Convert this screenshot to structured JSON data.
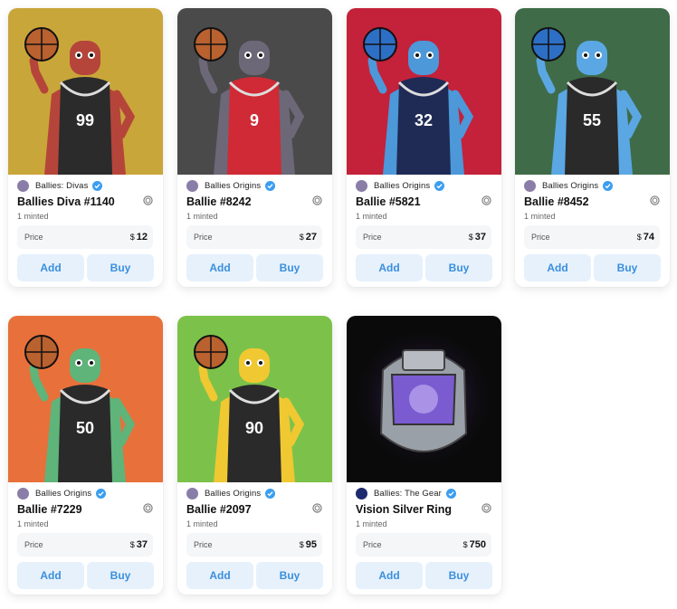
{
  "cards": [
    {
      "collection": "Ballies: Divas",
      "title": "Ballies Diva #1140",
      "minted": "1 minted",
      "price_label": "Price",
      "currency": "$",
      "price": "12",
      "add_label": "Add",
      "buy_label": "Buy",
      "bg": "#c9a63a",
      "jersey": "#2b2b2b",
      "skin": "#b5453a",
      "number": "99",
      "ball": "#b9612f"
    },
    {
      "collection": "Ballies Origins",
      "title": "Ballie #8242",
      "minted": "1 minted",
      "price_label": "Price",
      "currency": "$",
      "price": "27",
      "add_label": "Add",
      "buy_label": "Buy",
      "bg": "#4a4a4a",
      "jersey": "#cf2a35",
      "skin": "#6c6878",
      "number": "9",
      "ball": "#b9612f"
    },
    {
      "collection": "Ballies Origins",
      "title": "Ballie #5821",
      "minted": "1 minted",
      "price_label": "Price",
      "currency": "$",
      "price": "37",
      "add_label": "Add",
      "buy_label": "Buy",
      "bg": "#c4213a",
      "jersey": "#1f2b55",
      "skin": "#4c98d9",
      "number": "32",
      "ball": "#2d6fc4"
    },
    {
      "collection": "Ballies Origins",
      "title": "Ballie #8452",
      "minted": "1 minted",
      "price_label": "Price",
      "currency": "$",
      "price": "74",
      "add_label": "Add",
      "buy_label": "Buy",
      "bg": "#3f6b48",
      "jersey": "#2a2a2a",
      "skin": "#5aa7e3",
      "number": "55",
      "ball": "#2d6fc4"
    },
    {
      "collection": "Ballies Origins",
      "title": "Ballie #7229",
      "minted": "1 minted",
      "price_label": "Price",
      "currency": "$",
      "price": "37",
      "add_label": "Add",
      "buy_label": "Buy",
      "bg": "#e8703a",
      "jersey": "#2a2a2a",
      "skin": "#5fb47a",
      "number": "50",
      "ball": "#b9612f"
    },
    {
      "collection": "Ballies Origins",
      "title": "Ballie #2097",
      "minted": "1 minted",
      "price_label": "Price",
      "currency": "$",
      "price": "95",
      "add_label": "Add",
      "buy_label": "Buy",
      "bg": "#7cc24a",
      "jersey": "#2a2a2a",
      "skin": "#f0c832",
      "number": "90",
      "ball": "#b9612f"
    },
    {
      "collection": "Ballies: The Gear",
      "title": "Vision Silver Ring",
      "minted": "1 minted",
      "price_label": "Price",
      "currency": "$",
      "price": "750",
      "add_label": "Add",
      "buy_label": "Buy",
      "bg": "#0a0a0a",
      "jersey": "",
      "skin": "",
      "number": "",
      "ball": ""
    }
  ],
  "icons": {
    "verified": "verified-badge-icon",
    "chain": "chain-icon"
  },
  "colors": {
    "accent": "#3a8fdd",
    "button_bg": "#e6f1fc",
    "verified": "#3b9ef0"
  }
}
